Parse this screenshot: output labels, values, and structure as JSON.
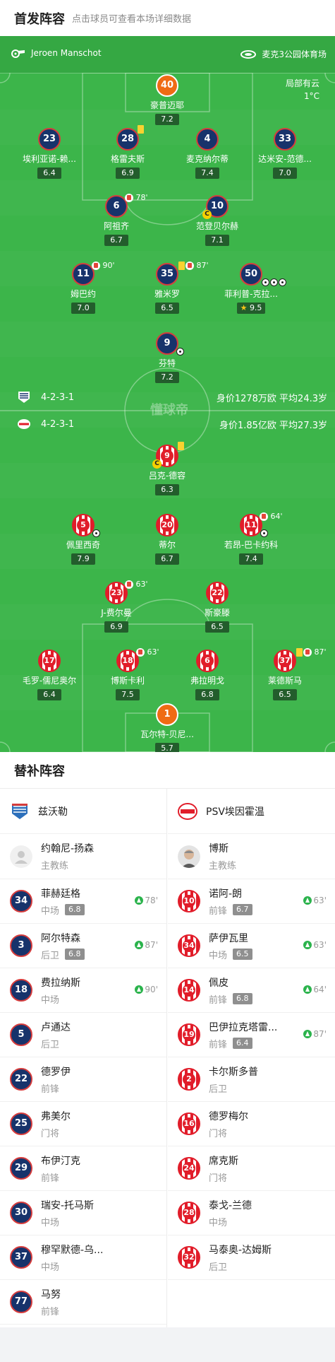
{
  "header": {
    "title": "首发阵容",
    "subtitle": "点击球员可查看本场详细数据"
  },
  "match": {
    "referee": "Jeroen Manschot",
    "venue": "麦克3公园体育场",
    "weather": "局部有云",
    "temperature": "1°C",
    "watermark": "懂球帝"
  },
  "home": {
    "formation": "4-2-3-1",
    "value": "身价1278万欧  平均24.3岁",
    "players": [
      {
        "id": "p40",
        "num": "40",
        "name": "豪普迈耶",
        "rating": "7.2"
      },
      {
        "id": "p23",
        "num": "23",
        "name": "埃利亚诺-赖...",
        "rating": "6.4"
      },
      {
        "id": "p28",
        "num": "28",
        "name": "格雷夫斯",
        "rating": "6.9"
      },
      {
        "id": "p4",
        "num": "4",
        "name": "麦克纳尔蒂",
        "rating": "7.4"
      },
      {
        "id": "p33",
        "num": "33",
        "name": "达米安-范德...",
        "rating": "7.0"
      },
      {
        "id": "p6",
        "num": "6",
        "name": "阿祖齐",
        "rating": "6.7",
        "event": "78'"
      },
      {
        "id": "p10",
        "num": "10",
        "name": "范登贝尔赫",
        "rating": "7.1",
        "captain": "C"
      },
      {
        "id": "p11",
        "num": "11",
        "name": "姆巴约",
        "rating": "7.0",
        "event": "90'"
      },
      {
        "id": "p35",
        "num": "35",
        "name": "雅米罗",
        "rating": "6.5",
        "event": "87'"
      },
      {
        "id": "p50",
        "num": "50",
        "name": "菲利普-克拉...",
        "rating": "9.5"
      },
      {
        "id": "p9",
        "num": "9",
        "name": "芬特",
        "rating": "7.2"
      }
    ]
  },
  "away": {
    "formation": "4-2-3-1",
    "value": "身价1.85亿欧  平均27.3岁",
    "players": [
      {
        "id": "a9",
        "num": "9",
        "name": "吕克-德容",
        "rating": "6.3",
        "captain": "C"
      },
      {
        "id": "a5",
        "num": "5",
        "name": "佩里西奇",
        "rating": "7.9"
      },
      {
        "id": "a20",
        "num": "20",
        "name": "蒂尔",
        "rating": "6.7"
      },
      {
        "id": "a11",
        "num": "11",
        "name": "若昂-巴卡约科",
        "rating": "7.4",
        "event": "64'"
      },
      {
        "id": "a23",
        "num": "23",
        "name": "J-费尔曼",
        "rating": "6.9",
        "event": "63'"
      },
      {
        "id": "a22",
        "num": "22",
        "name": "斯豪滕",
        "rating": "6.5"
      },
      {
        "id": "a17",
        "num": "17",
        "name": "毛罗-儒尼奥尔",
        "rating": "6.4"
      },
      {
        "id": "a18",
        "num": "18",
        "name": "博斯卡利",
        "rating": "7.5",
        "event": "63'"
      },
      {
        "id": "a6",
        "num": "6",
        "name": "弗拉明戈",
        "rating": "6.8"
      },
      {
        "id": "a37",
        "num": "37",
        "name": "莱德斯马",
        "rating": "6.5",
        "event": "87'"
      },
      {
        "id": "a1",
        "num": "1",
        "name": "瓦尔特-贝尼...",
        "rating": "5.7"
      }
    ]
  },
  "subs": {
    "title": "替补阵容",
    "home": {
      "team": "兹沃勒",
      "coach": {
        "name": "约翰尼-扬森",
        "role": "主教练"
      },
      "list": [
        {
          "num": "34",
          "name": "菲赫廷格",
          "pos": "中场",
          "rating": "6.8",
          "on": "78'"
        },
        {
          "num": "3",
          "name": "阿尔特森",
          "pos": "后卫",
          "rating": "6.8",
          "on": "87'"
        },
        {
          "num": "18",
          "name": "费拉纳斯",
          "pos": "中场",
          "rating": "",
          "on": "90'"
        },
        {
          "num": "5",
          "name": "卢通达",
          "pos": "后卫",
          "rating": "",
          "on": ""
        },
        {
          "num": "22",
          "name": "德罗伊",
          "pos": "前锋",
          "rating": "",
          "on": ""
        },
        {
          "num": "25",
          "name": "弗美尔",
          "pos": "门将",
          "rating": "",
          "on": ""
        },
        {
          "num": "29",
          "name": "布伊汀克",
          "pos": "前锋",
          "rating": "",
          "on": ""
        },
        {
          "num": "30",
          "name": "瑞安-托马斯",
          "pos": "中场",
          "rating": "",
          "on": ""
        },
        {
          "num": "37",
          "name": "穆罕默德-乌...",
          "pos": "中场",
          "rating": "",
          "on": ""
        },
        {
          "num": "77",
          "name": "马努",
          "pos": "前锋",
          "rating": "",
          "on": ""
        }
      ]
    },
    "away": {
      "team": "PSV埃因霍温",
      "coach": {
        "name": "博斯",
        "role": "主教练"
      },
      "list": [
        {
          "num": "10",
          "name": "诺阿-朗",
          "pos": "前锋",
          "rating": "6.7",
          "on": "63'"
        },
        {
          "num": "34",
          "name": "萨伊瓦里",
          "pos": "中场",
          "rating": "6.5",
          "on": "63'"
        },
        {
          "num": "14",
          "name": "佩皮",
          "pos": "前锋",
          "rating": "6.8",
          "on": "64'"
        },
        {
          "num": "19",
          "name": "巴伊拉克塔雷...",
          "pos": "前锋",
          "rating": "6.4",
          "on": "87'"
        },
        {
          "num": "2",
          "name": "卡尔斯多普",
          "pos": "后卫",
          "rating": "",
          "on": ""
        },
        {
          "num": "16",
          "name": "德罗梅尔",
          "pos": "门将",
          "rating": "",
          "on": ""
        },
        {
          "num": "24",
          "name": "席克斯",
          "pos": "门将",
          "rating": "",
          "on": ""
        },
        {
          "num": "28",
          "name": "泰戈-兰德",
          "pos": "中场",
          "rating": "",
          "on": ""
        },
        {
          "num": "32",
          "name": "马泰奥-达姆斯",
          "pos": "后卫",
          "rating": "",
          "on": ""
        }
      ]
    }
  },
  "colors": {
    "pitch": "#3cb54a",
    "home_shirt": "#17336b",
    "away_shirt": "#e11d2a",
    "gk_shirt": "#ef6b14"
  }
}
